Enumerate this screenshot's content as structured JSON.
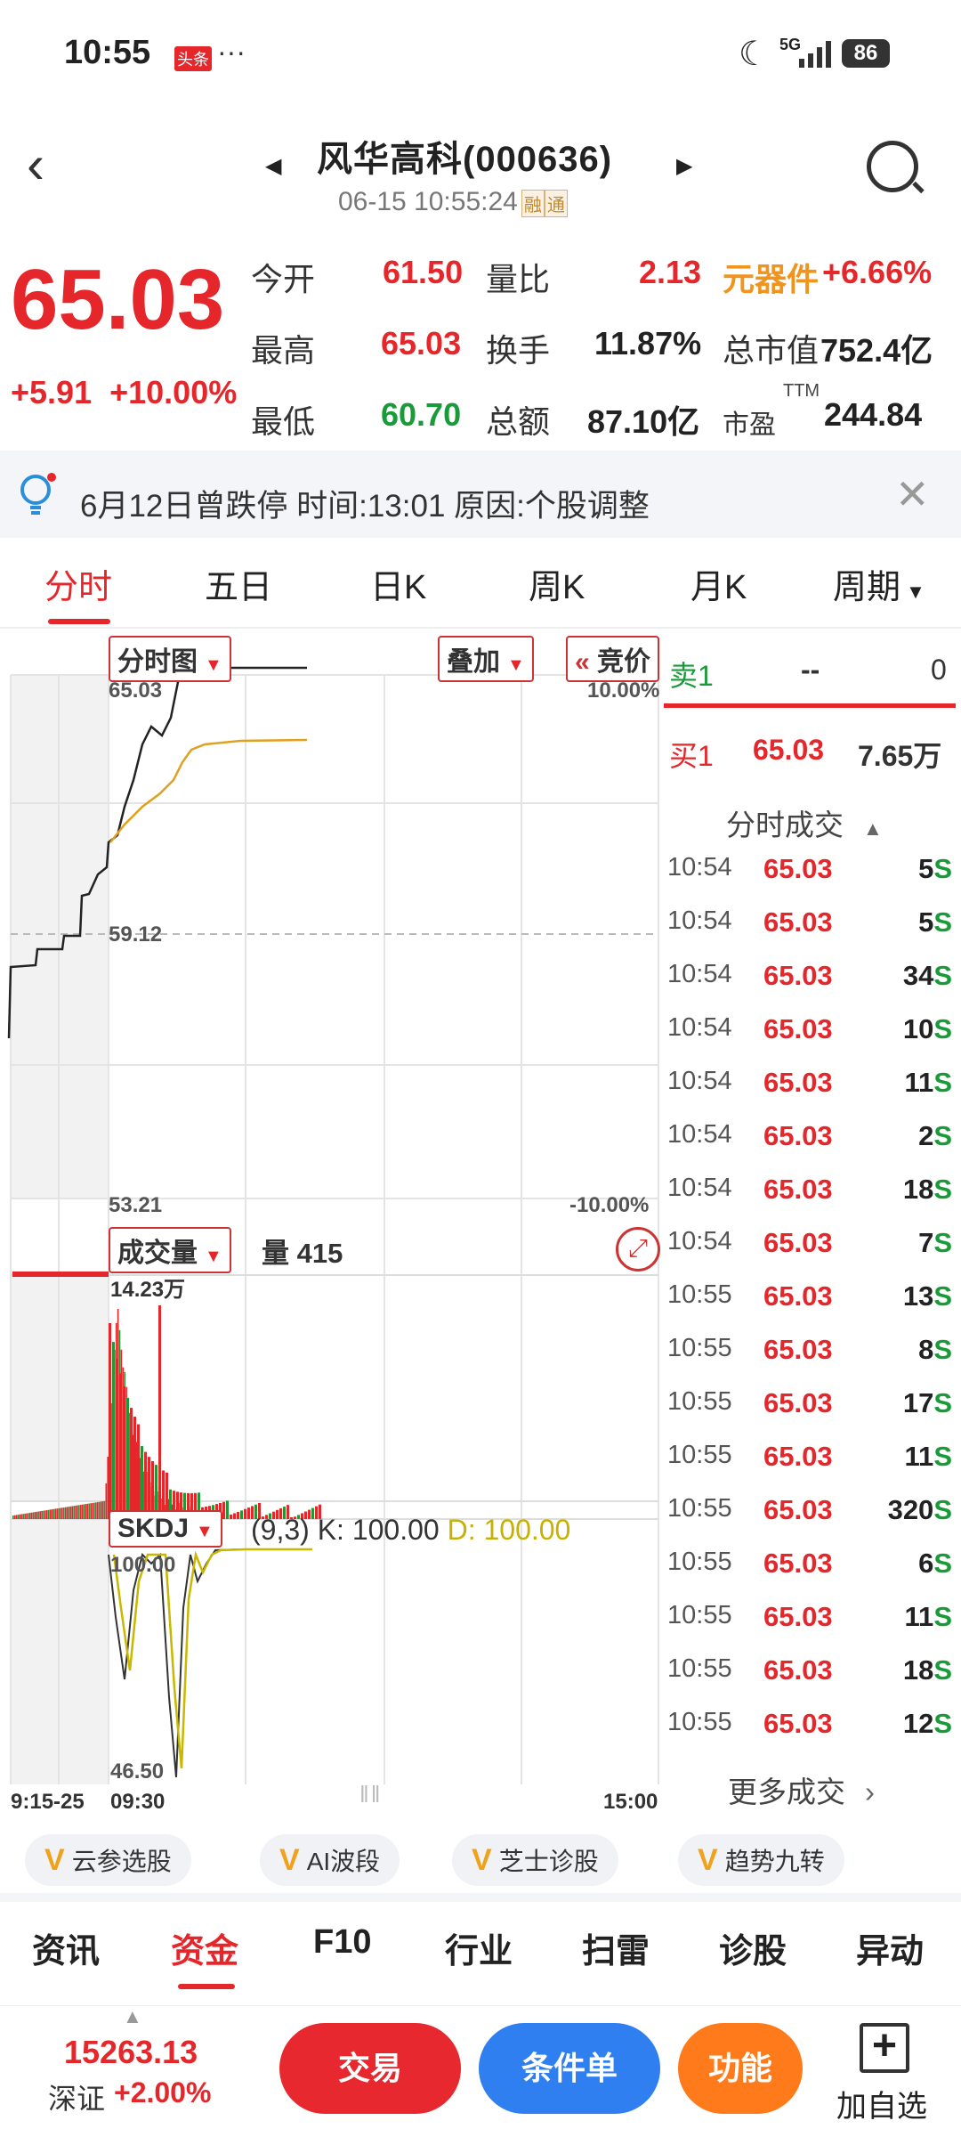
{
  "status": {
    "time": "10:55",
    "badge": "头条",
    "dots": "···",
    "network": "5G",
    "battery": "86"
  },
  "header": {
    "title": "风华高科(000636)",
    "datetime": "06-15 10:55:24",
    "tags": [
      "融",
      "通"
    ]
  },
  "quote": {
    "price": "65.03",
    "change": "+5.91",
    "change_pct": "+10.00%",
    "rows": [
      {
        "l1": "今开",
        "v1": "61.50",
        "l2": "量比",
        "v2": "2.13",
        "l3": "元器件",
        "v3": "+6.66%"
      },
      {
        "l1": "最高",
        "v1": "65.03",
        "l2": "换手",
        "v2": "11.87%",
        "l3": "总市值",
        "v3": "752.4亿"
      },
      {
        "l1": "最低",
        "v1": "60.70",
        "l2": "总额",
        "v2": "87.10亿",
        "l3": "市盈",
        "l3_sup": "TTM",
        "v3": "244.84"
      }
    ]
  },
  "notice": {
    "text": "6月12日曾跌停   时间:13:01   原因:个股调整"
  },
  "tabs": [
    "分时",
    "五日",
    "日K",
    "周K",
    "月K",
    "周期"
  ],
  "chart": {
    "selector": "分时图",
    "overlay": "叠加",
    "auction": "竞价",
    "price_max": "65.03",
    "price_mid": "59.12",
    "price_min": "53.21",
    "pct_max": "10.00%",
    "pct_min": "-10.00%",
    "volume_label": "成交量",
    "volume_text": "量 415",
    "volume_max": "14.23万",
    "indicator": "SKDJ",
    "indicator_params": "(9,3)",
    "k_text": "K: 100.00",
    "d_text": "D: 100.00",
    "ind_max": "100.00",
    "ind_min": "46.50",
    "time_start": "9:15-25",
    "time_open": "09:30",
    "time_end": "15:00",
    "colors": {
      "price_line": "#222222",
      "avg_line": "#e0a020",
      "up": "#e5262b",
      "down": "#1a9b3a",
      "k_line": "#c8b800"
    }
  },
  "orderbook": {
    "sell1_label": "卖1",
    "sell1_price": "--",
    "sell1_vol": "0",
    "buy1_label": "买1",
    "buy1_price": "65.03",
    "buy1_vol": "7.65万",
    "trades_title": "分时成交",
    "trades": [
      {
        "t": "10:54",
        "p": "65.03",
        "v": "5"
      },
      {
        "t": "10:54",
        "p": "65.03",
        "v": "5"
      },
      {
        "t": "10:54",
        "p": "65.03",
        "v": "34"
      },
      {
        "t": "10:54",
        "p": "65.03",
        "v": "10"
      },
      {
        "t": "10:54",
        "p": "65.03",
        "v": "11"
      },
      {
        "t": "10:54",
        "p": "65.03",
        "v": "2"
      },
      {
        "t": "10:54",
        "p": "65.03",
        "v": "18"
      },
      {
        "t": "10:54",
        "p": "65.03",
        "v": "7"
      },
      {
        "t": "10:55",
        "p": "65.03",
        "v": "13"
      },
      {
        "t": "10:55",
        "p": "65.03",
        "v": "8"
      },
      {
        "t": "10:55",
        "p": "65.03",
        "v": "17"
      },
      {
        "t": "10:55",
        "p": "65.03",
        "v": "11"
      },
      {
        "t": "10:55",
        "p": "65.03",
        "v": "320"
      },
      {
        "t": "10:55",
        "p": "65.03",
        "v": "6"
      },
      {
        "t": "10:55",
        "p": "65.03",
        "v": "11"
      },
      {
        "t": "10:55",
        "p": "65.03",
        "v": "18"
      },
      {
        "t": "10:55",
        "p": "65.03",
        "v": "12"
      }
    ],
    "side_mark": "S",
    "more": "更多成交"
  },
  "chips": [
    "云参选股",
    "AI波段",
    "芝士诊股",
    "趋势九转"
  ],
  "bottom_tabs": [
    "资讯",
    "资金",
    "F10",
    "行业",
    "扫雷",
    "诊股",
    "异动"
  ],
  "bottom_bar": {
    "index_value": "15263.13",
    "index_name": "深证",
    "index_change": "+2.00%",
    "trade": "交易",
    "condition": "条件单",
    "function": "功能",
    "add_fav": "加自选",
    "colors": {
      "trade": "#e8282f",
      "condition": "#2f7ff0",
      "function": "#ff7a1a"
    }
  }
}
